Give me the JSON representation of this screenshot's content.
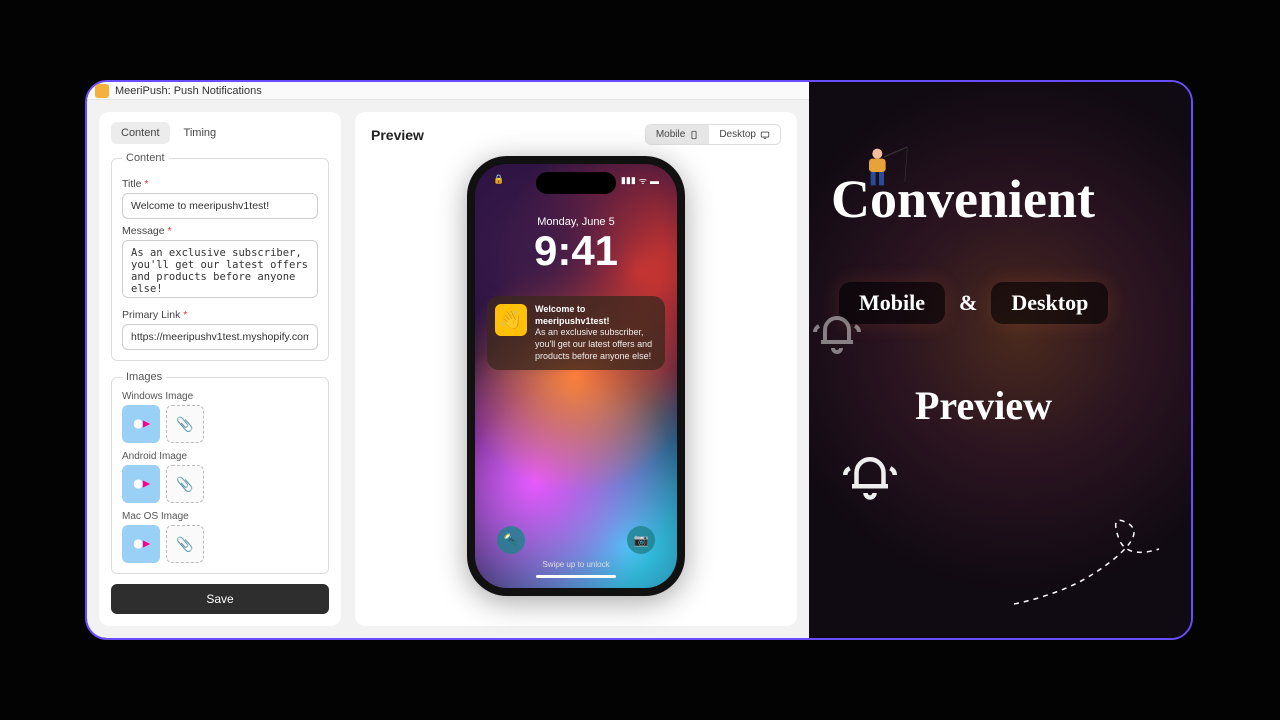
{
  "window": {
    "title": "MeeriPush: Push Notifications"
  },
  "tabs": {
    "content": "Content",
    "timing": "Timing"
  },
  "form": {
    "content_legend": "Content",
    "title_label": "Title",
    "title_value": "Welcome to meeripushv1test!",
    "message_label": "Message",
    "message_value": "As an exclusive subscriber, you'll get our latest offers and products before anyone else!",
    "link_label": "Primary Link",
    "link_value": "https://meeripushv1test.myshopify.com",
    "images_legend": "Images",
    "img_windows": "Windows Image",
    "img_android": "Android Image",
    "img_macos": "Mac OS Image",
    "save": "Save"
  },
  "preview": {
    "heading": "Preview",
    "mobile": "Mobile",
    "desktop": "Desktop",
    "phone_date": "Monday, June 5",
    "phone_time": "9:41",
    "notif_title": "Welcome to meeripushv1test!",
    "notif_msg": "As an exclusive subscriber, you'll get our latest offers and products before anyone else!",
    "swipe": "Swipe up to unlock",
    "lock": "🔒"
  },
  "promo": {
    "headline": "Convenient",
    "mobile": "Mobile",
    "amp": "&",
    "desktop": "Desktop",
    "preview": "Preview"
  }
}
